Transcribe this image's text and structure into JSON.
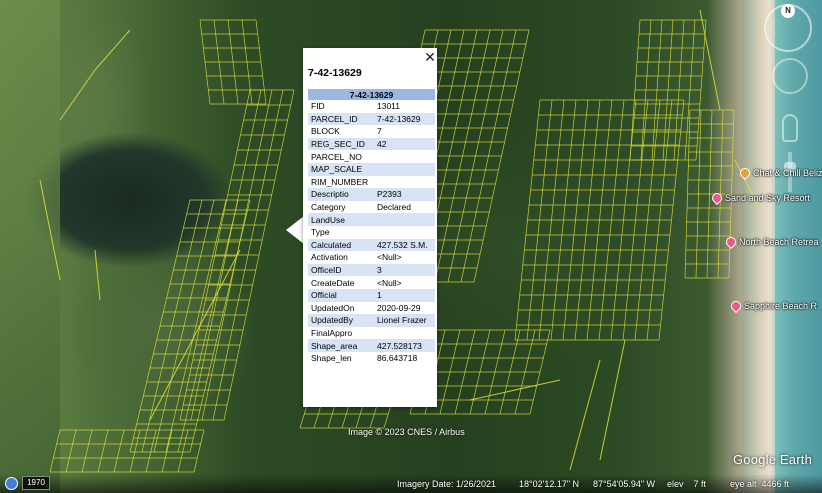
{
  "map": {
    "copyright": "Image © 2023 CNES / Airbus",
    "compass_north": "N",
    "placemarks": [
      {
        "name": "Chat & Chill Beliz",
        "icon": "orange-pin-icon"
      },
      {
        "name": "Sand and Sky Resort",
        "icon": "pink-pin-icon"
      },
      {
        "name": "North Beach Retrea",
        "icon": "pink-pin-icon"
      },
      {
        "name": "Sapphire Beach R",
        "icon": "pink-pin-icon"
      }
    ]
  },
  "popup": {
    "title": "7-42-13629",
    "table_header": "7-42-13629",
    "rows": [
      {
        "field": "FID",
        "value": "13011"
      },
      {
        "field": "PARCEL_ID",
        "value": "7-42-13629"
      },
      {
        "field": "BLOCK",
        "value": "7"
      },
      {
        "field": "REG_SEC_ID",
        "value": "42"
      },
      {
        "field": "PARCEL_NO",
        "value": ""
      },
      {
        "field": "MAP_SCALE",
        "value": ""
      },
      {
        "field": "RIM_NUMBER",
        "value": ""
      },
      {
        "field": "Descriptio",
        "value": "P2393"
      },
      {
        "field": "Category",
        "value": "Declared"
      },
      {
        "field": "LandUse",
        "value": ""
      },
      {
        "field": "Type",
        "value": ""
      },
      {
        "field": "Calculated",
        "value": "427.532 S.M."
      },
      {
        "field": "Activation",
        "value": "<Null>"
      },
      {
        "field": "OfficeID",
        "value": "3"
      },
      {
        "field": "CreateDate",
        "value": "<Null>"
      },
      {
        "field": "Official",
        "value": "1"
      },
      {
        "field": "UpdatedOn",
        "value": "2020-09-29"
      },
      {
        "field": "UpdatedBy",
        "value": "Lionel Frazer"
      },
      {
        "field": "FinalAppro",
        "value": ""
      },
      {
        "field": "Shape_area",
        "value": "427.528173"
      },
      {
        "field": "Shape_len",
        "value": "86.643718"
      }
    ],
    "close_glyph": "✕"
  },
  "status": {
    "historical_year": "1970",
    "imagery_date": "Imagery Date: 1/26/2021",
    "latitude": "18°02'12.17\" N",
    "longitude": "87°54'05.94\" W",
    "elevation": "elev    7 ft",
    "eye_alt": "eye alt  4466 ft"
  },
  "branding": {
    "logo": "Google Earth"
  },
  "colors": {
    "parcel_lines": "#e4e23a",
    "table_header_bg": "#9bb8e2",
    "table_alt_row_bg": "#d8e4f5",
    "pin_pink": "#e85a8c",
    "pin_orange": "#e8a22e"
  }
}
